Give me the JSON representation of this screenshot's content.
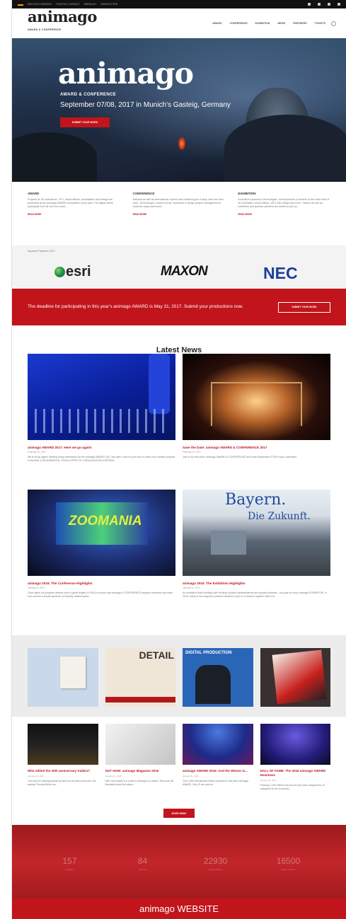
{
  "topbar": {
    "links": [
      "DEUTSCH VERSION",
      "TICKETS | CONTACT",
      "MEDIA KIT",
      "NEWSLETTER"
    ]
  },
  "nav": {
    "logo": "animago",
    "logo_sub": "AWARD & CONFERENCE",
    "items": [
      "AWARD",
      "CONFERENCE",
      "EXHIBITION",
      "NEWS",
      "PARTNERS",
      "TICKETS"
    ]
  },
  "hero": {
    "title": "animago",
    "subtitle": "AWARD & CONFERENCE",
    "date": "September 07/08, 2017 in Munich's Gasteig, Germany",
    "button": "SUBMIT YOUR WORK"
  },
  "features": [
    {
      "title": "AWARD",
      "text": "Projects on 3D animations, VFX, visual effects, visualization and design are presented at the animago AWARD competition every year. The digital artists participate from all over the world...",
      "more": "READ MORE"
    },
    {
      "title": "CONFERENCE",
      "text": "National as well as international experts and creatives give a deep view into their work. Technologies, current trends, workflows & design project management & business topics and more...",
      "more": "READ MORE"
    },
    {
      "title": "EXHIBITION",
      "text": "Innovative products & technologies, developments & services in the entire field of 3D animation, visual effects, VR & 360 design and more. Visitors as well as exhibitors and sponsor partners are invited to join us...",
      "more": "READ MORE"
    }
  ],
  "sponsors": {
    "label": "Sponsor Partners 2017",
    "logos": [
      "esri",
      "MAXON",
      "NEC"
    ]
  },
  "deadline": {
    "text": "The deadline for participating in this year's animago AWARD is May 31, 2017. Submit your productions now.",
    "button": "SUBMIT YOUR WORK"
  },
  "latest_news": {
    "heading": "Latest News",
    "cards": [
      {
        "title": "animago AWARD 2017: Here we go again!",
        "date": "February 01, 2017",
        "text": "We're let go again! Starting today admissions for the animago AWARD 2017 are open. Now it's your turn to enter your creative projects in the field of 3D ANIMATION, VISUAL EFFECTS, VISUALIZATION & DESIGN..."
      },
      {
        "title": "Save the Date: animago AWARD & CONFERENCE 2017",
        "date": "February 01, 2017",
        "text": "Join us for this year's animago AWARD & CONFERENCE and mark September 07/08 in your calendars!"
      },
      {
        "title": "animago 2016: The Conference Highlights",
        "date": "January 01, 2017",
        "text": "Once again our program director went a great lengths in 2016 to ensure that animago's CONFERENCE program remained top-notch and covered a broad spectrum of industry related topics..."
      },
      {
        "title": "animago 2016: The Exhibition Highlights",
        "date": "January 01, 2017",
        "text": "An exhibition that's bristling with exciting industry representatives and special activities - our goal for every animago EXHIBITION. In 2016, many of our long-term partners decided to join us in Munich together with a bi..."
      }
    ],
    "zoo_text": "ZOOMANIA",
    "bay_text": "Bayern.",
    "bay_sub": "Die Zukunft."
  },
  "magazines": {
    "detail_text": "DETAIL",
    "dp_text": "DIGITAL PRODUCTION"
  },
  "more_news": [
    {
      "title": "Who edited the 20th anniversary trailers?",
      "date": "January 01, 2017",
      "text": "This year the animago guests by have we secured sound and. We seadsal Thomas Bichler as..."
    },
    {
      "title": "OUT NOW: animago Magazine 2016",
      "date": "January 01, 2017",
      "text": "Well, how exactly is a model is animago is a reader? Who puts the Mandala format that obtain..."
    },
    {
      "title": "animago AWARD 2016: And the Winner is...",
      "date": "January 01, 2017",
      "text": "Over 1000 international entries competed in this year's animago AWARD. Only 13 are now be..."
    },
    {
      "title": "HALL OF FAME: The 2016 animago AWARD Nominees",
      "date": "January 01, 2017",
      "text": "Precisely 1,000 entries from all over the world competed for 13 categories for the renowned..."
    }
  ],
  "more_button": "MORE NEWS",
  "stats": [
    {
      "num": "157",
      "label": "Speakers"
    },
    {
      "num": "84",
      "label": "Partners"
    },
    {
      "num": "22930",
      "label": "Project Entries"
    },
    {
      "num": "16500",
      "label": "Expert Visitors"
    }
  ],
  "caption": "animago WEBSITE",
  "colors": {
    "brand_red": "#c2141b",
    "dark": "#111111"
  }
}
